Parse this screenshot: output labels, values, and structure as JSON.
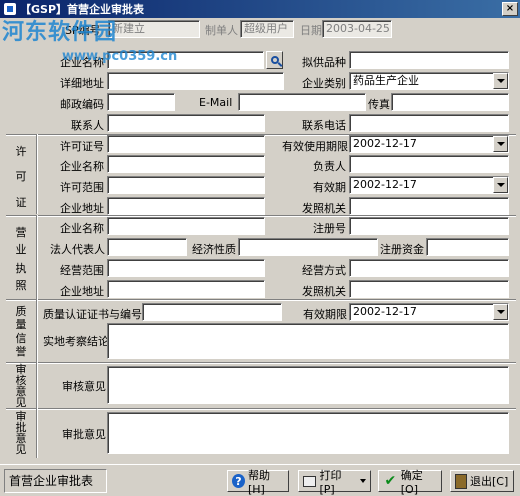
{
  "window": {
    "title": "【GSP】首营企业审批表",
    "close_glyph": "×"
  },
  "watermark": {
    "text": "河东软件园",
    "url": "www.pc0359.cn"
  },
  "header": {
    "doc_no_label": "SP编号",
    "doc_no_value": "新建立",
    "maker_label": "制单人",
    "maker_value": "超级用户",
    "date_label": "日期",
    "date_value": "2003-04-25"
  },
  "basic": {
    "company_name_label": "企业名称",
    "company_name_value": "",
    "supply_label": "拟供品种",
    "supply_value": "",
    "address_label": "详细地址",
    "address_value": "",
    "category_label": "企业类别",
    "category_value": "药品生产企业",
    "zip_label": "邮政编码",
    "zip_value": "",
    "email_label": "E-Mail",
    "email_value": "",
    "fax_label": "传真",
    "fax_value": "",
    "contact_label": "联系人",
    "contact_value": "",
    "phone_label": "联系电话",
    "phone_value": ""
  },
  "license": {
    "section_chars": [
      "许",
      "可",
      "证"
    ],
    "number_label": "许可证号",
    "number_value": "",
    "valid_until_label": "有效使用期限",
    "valid_until_value": "2002-12-17",
    "name_label": "企业名称",
    "name_value": "",
    "person_label": "负责人",
    "person_value": "",
    "scope_label": "许可范围",
    "scope_value": "",
    "valid_label": "有效期",
    "valid_value": "2002-12-17",
    "address_label": "企业地址",
    "address_value": "",
    "issuer_label": "发照机关",
    "issuer_value": ""
  },
  "business": {
    "section_chars": [
      "营",
      "业",
      "执",
      "照"
    ],
    "name_label": "企业名称",
    "name_value": "",
    "reg_label": "注册号",
    "reg_value": "",
    "legal_label": "法人代表人",
    "legal_value": "",
    "nature_label": "经济性质",
    "nature_value": "",
    "capital_label": "注册资金",
    "capital_value": "",
    "scope_label": "经营范围",
    "scope_value": "",
    "mode_label": "经营方式",
    "mode_value": "",
    "address_label": "企业地址",
    "address_value": "",
    "issuer_label": "发照机关",
    "issuer_value": ""
  },
  "quality": {
    "section_chars": [
      "质",
      "量",
      "信",
      "誉"
    ],
    "cert_label": "质量认证证书与编号",
    "cert_value": "",
    "valid_label": "有效期限",
    "valid_value": "2002-12-17",
    "inspect_label": "实地考察结论",
    "inspect_value": ""
  },
  "review": {
    "section_chars": [
      "审",
      "核",
      "意",
      "见"
    ],
    "label": "审核意见",
    "value": ""
  },
  "approve": {
    "section_chars": [
      "审",
      "批",
      "意",
      "见"
    ],
    "label": "审批意见",
    "value": ""
  },
  "statusbar": {
    "text": "首营企业审批表"
  },
  "buttons": {
    "help": "帮助[H]",
    "help_glyph": "?",
    "print": "打印[P]",
    "ok": "确定[O]",
    "ok_glyph": "✔",
    "exit": "退出[C]"
  }
}
